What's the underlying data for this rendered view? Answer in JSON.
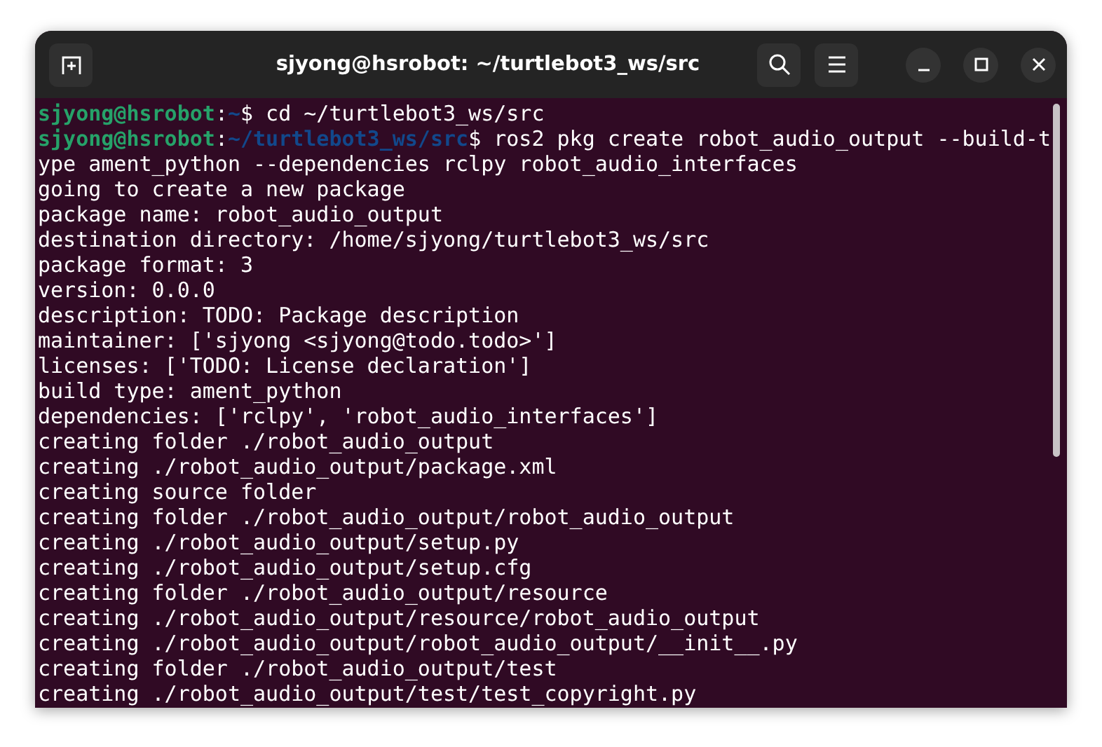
{
  "window": {
    "title": "sjyong@hsrobot: ~/turtlebot3_ws/src"
  },
  "terminal": {
    "lines": [
      {
        "kind": "prompt",
        "user": "sjyong@hsrobot",
        "separator": ":",
        "path": "~",
        "command": "$ cd ~/turtlebot3_ws/src"
      },
      {
        "kind": "prompt",
        "user": "sjyong@hsrobot",
        "separator": ":",
        "path": "~/turtlebot3_ws/src",
        "command": "$ ros2 pkg create robot_audio_output --build-t"
      },
      {
        "kind": "output",
        "text": "ype ament_python --dependencies rclpy robot_audio_interfaces"
      },
      {
        "kind": "output",
        "text": "going to create a new package"
      },
      {
        "kind": "output",
        "text": "package name: robot_audio_output"
      },
      {
        "kind": "output",
        "text": "destination directory: /home/sjyong/turtlebot3_ws/src"
      },
      {
        "kind": "output",
        "text": "package format: 3"
      },
      {
        "kind": "output",
        "text": "version: 0.0.0"
      },
      {
        "kind": "output",
        "text": "description: TODO: Package description"
      },
      {
        "kind": "output",
        "text": "maintainer: ['sjyong <sjyong@todo.todo>']"
      },
      {
        "kind": "output",
        "text": "licenses: ['TODO: License declaration']"
      },
      {
        "kind": "output",
        "text": "build type: ament_python"
      },
      {
        "kind": "output",
        "text": "dependencies: ['rclpy', 'robot_audio_interfaces']"
      },
      {
        "kind": "output",
        "text": "creating folder ./robot_audio_output"
      },
      {
        "kind": "output",
        "text": "creating ./robot_audio_output/package.xml"
      },
      {
        "kind": "output",
        "text": "creating source folder"
      },
      {
        "kind": "output",
        "text": "creating folder ./robot_audio_output/robot_audio_output"
      },
      {
        "kind": "output",
        "text": "creating ./robot_audio_output/setup.py"
      },
      {
        "kind": "output",
        "text": "creating ./robot_audio_output/setup.cfg"
      },
      {
        "kind": "output",
        "text": "creating folder ./robot_audio_output/resource"
      },
      {
        "kind": "output",
        "text": "creating ./robot_audio_output/resource/robot_audio_output"
      },
      {
        "kind": "output",
        "text": "creating ./robot_audio_output/robot_audio_output/__init__.py"
      },
      {
        "kind": "output",
        "text": "creating folder ./robot_audio_output/test"
      },
      {
        "kind": "output",
        "text": "creating ./robot_audio_output/test/test_copyright.py"
      }
    ]
  }
}
